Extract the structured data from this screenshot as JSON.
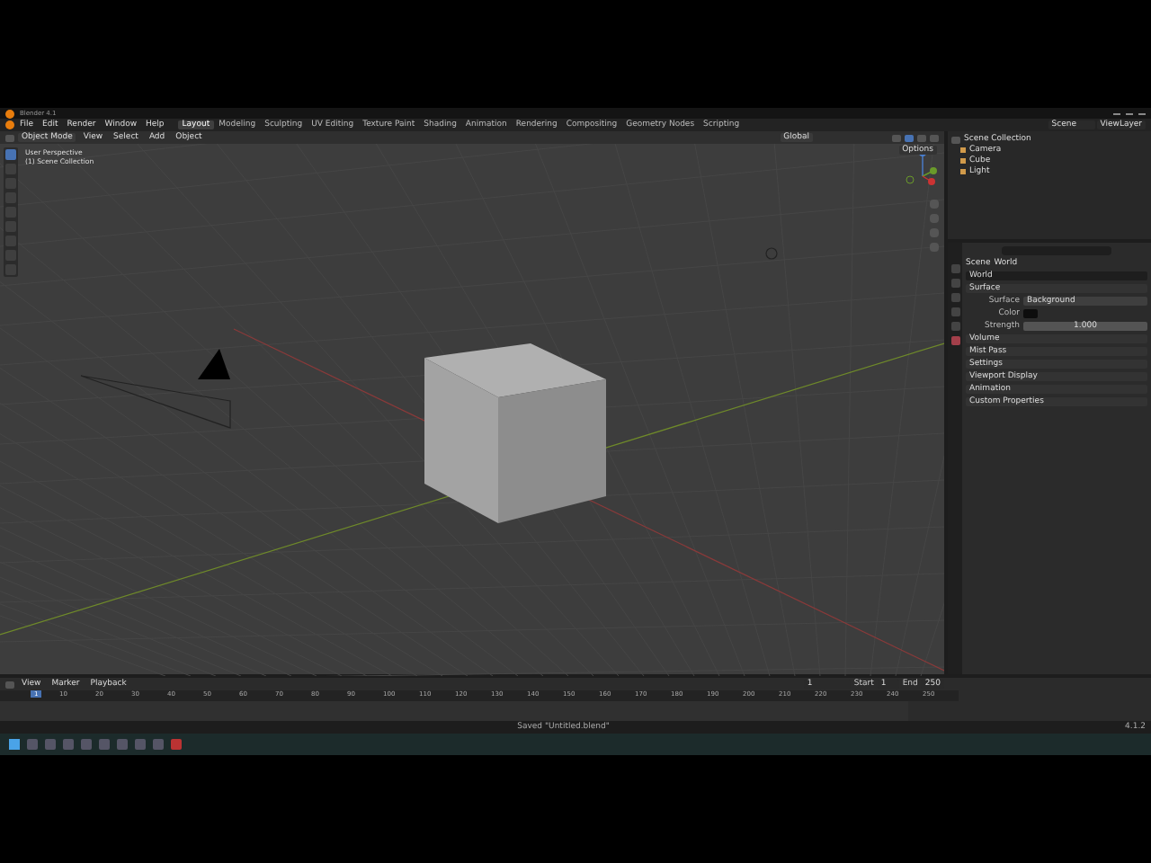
{
  "window": {
    "title": "Blender 4.1"
  },
  "menus": [
    "File",
    "Edit",
    "Render",
    "Window",
    "Help"
  ],
  "workspaces": [
    {
      "label": "Layout",
      "selected": true
    },
    {
      "label": "Modeling",
      "selected": false
    },
    {
      "label": "Sculpting",
      "selected": false
    },
    {
      "label": "UV Editing",
      "selected": false
    },
    {
      "label": "Texture Paint",
      "selected": false
    },
    {
      "label": "Shading",
      "selected": false
    },
    {
      "label": "Animation",
      "selected": false
    },
    {
      "label": "Rendering",
      "selected": false
    },
    {
      "label": "Compositing",
      "selected": false
    },
    {
      "label": "Geometry Nodes",
      "selected": false
    },
    {
      "label": "Scripting",
      "selected": false
    }
  ],
  "scene_field": "Scene",
  "view_layer_field": "ViewLayer",
  "viewport": {
    "mode": "Object Mode",
    "menus": [
      "View",
      "Select",
      "Add",
      "Object"
    ],
    "orientation": "Global",
    "shading": [
      {
        "selected": false
      },
      {
        "selected": true
      },
      {
        "selected": false
      },
      {
        "selected": false
      }
    ],
    "overlay_lines": [
      "User Perspective",
      "(1) Scene Collection"
    ],
    "options": "Options",
    "tools": [
      {
        "selected": true
      },
      {
        "selected": false
      },
      {
        "selected": false
      },
      {
        "selected": false
      },
      {
        "selected": false
      },
      {
        "selected": false
      },
      {
        "selected": false
      },
      {
        "selected": false
      },
      {
        "selected": false
      }
    ]
  },
  "outliner": {
    "root": "Scene Collection",
    "items": [
      "Camera",
      "Cube",
      "Light"
    ]
  },
  "properties": {
    "breadcrumb": [
      "Scene",
      "World"
    ],
    "datablock": "World",
    "tabs": [
      {
        "selected": false
      },
      {
        "selected": false
      },
      {
        "selected": false
      },
      {
        "selected": false
      },
      {
        "selected": false
      },
      {
        "selected": true
      }
    ],
    "surface_header": "Surface",
    "fields": [
      {
        "label": "Surface",
        "value": "Background",
        "kind": "link"
      },
      {
        "label": "Color",
        "kind": "color"
      },
      {
        "label": "Strength",
        "value": "1.000",
        "kind": "number"
      }
    ],
    "panels": [
      "Volume",
      "Mist Pass",
      "Settings",
      "Viewport Display",
      "Animation",
      "Custom Properties"
    ]
  },
  "timeline": {
    "menus": [
      "View",
      "Marker",
      "Playback"
    ],
    "current_frame": "1",
    "playhead_frame": "1",
    "start_label": "Start",
    "start": "1",
    "end_label": "End",
    "end": "250",
    "ticks": [
      "10",
      "20",
      "30",
      "40",
      "50",
      "60",
      "70",
      "80",
      "90",
      "100",
      "110",
      "120",
      "130",
      "140",
      "150",
      "160",
      "170",
      "180",
      "190",
      "200",
      "210",
      "220",
      "230",
      "240",
      "250"
    ]
  },
  "status_bar": {
    "message": "Saved \"Untitled.blend\"",
    "version": "4.1.2"
  },
  "taskbar": {
    "apps": [
      {
        "selected": false
      },
      {
        "selected": false
      },
      {
        "selected": false
      },
      {
        "selected": false
      },
      {
        "selected": false
      },
      {
        "selected": false
      },
      {
        "selected": false
      },
      {
        "selected": false
      },
      {
        "selected": true
      }
    ]
  }
}
